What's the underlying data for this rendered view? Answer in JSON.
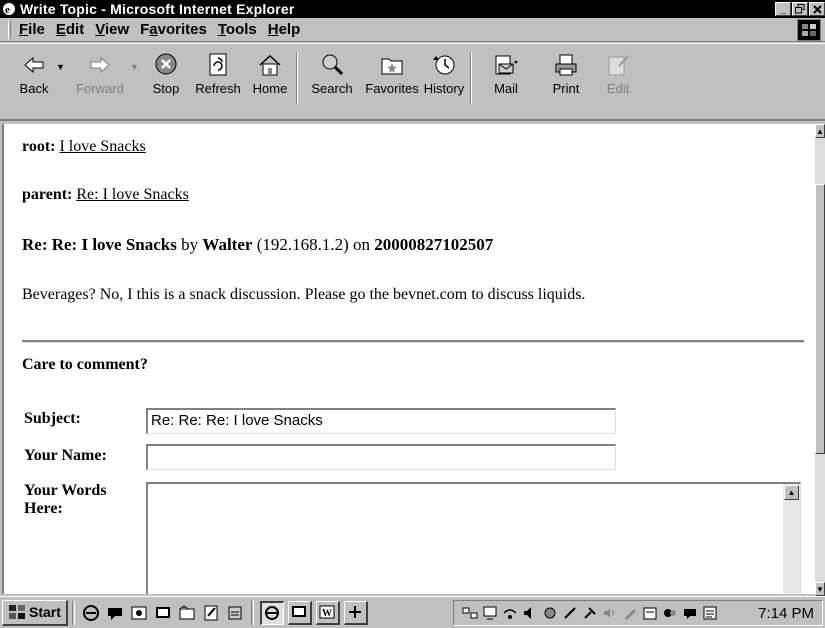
{
  "window": {
    "title": "Write Topic - Microsoft Internet Explorer",
    "buttons": [
      "_",
      "Ɖ",
      "×"
    ]
  },
  "menu": {
    "items": [
      {
        "ul": "F",
        "rest": "ile"
      },
      {
        "ul": "E",
        "rest": "dit"
      },
      {
        "ul": "V",
        "rest": "iew"
      },
      {
        "pre": "F",
        "ul": "a",
        "rest": "vorites"
      },
      {
        "ul": "T",
        "rest": "ools"
      },
      {
        "ul": "H",
        "rest": "elp"
      }
    ]
  },
  "toolbar": {
    "back": "Back",
    "forward": "Forward",
    "stop": "Stop",
    "refresh": "Refresh",
    "home": "Home",
    "search": "Search",
    "favorites": "Favorites",
    "history": "History",
    "mail": "Mail",
    "print": "Print",
    "edit": "Edit"
  },
  "page": {
    "root_label": "root:",
    "root_link": "I love Snacks",
    "parent_label": "parent:",
    "parent_link": "Re: I love Snacks",
    "post_title": "Re: Re: I love Snacks",
    "by_text": "by",
    "author": "Walter",
    "ip": "(192.168.1.2)",
    "on_text": "on",
    "timestamp": "20000827102507",
    "body": "Beverages? No, I this is a snack discussion. Please go the bevnet.com to discuss liquids.",
    "comment_heading": "Care to comment?",
    "subject_label": "Subject:",
    "subject_value": "Re: Re: Re: I love Snacks",
    "name_label": "Your Name:",
    "name_value": "",
    "words_label_1": "Your Words",
    "words_label_2": "Here:"
  },
  "taskbar": {
    "start": "Start",
    "clock": "7:14 PM"
  }
}
